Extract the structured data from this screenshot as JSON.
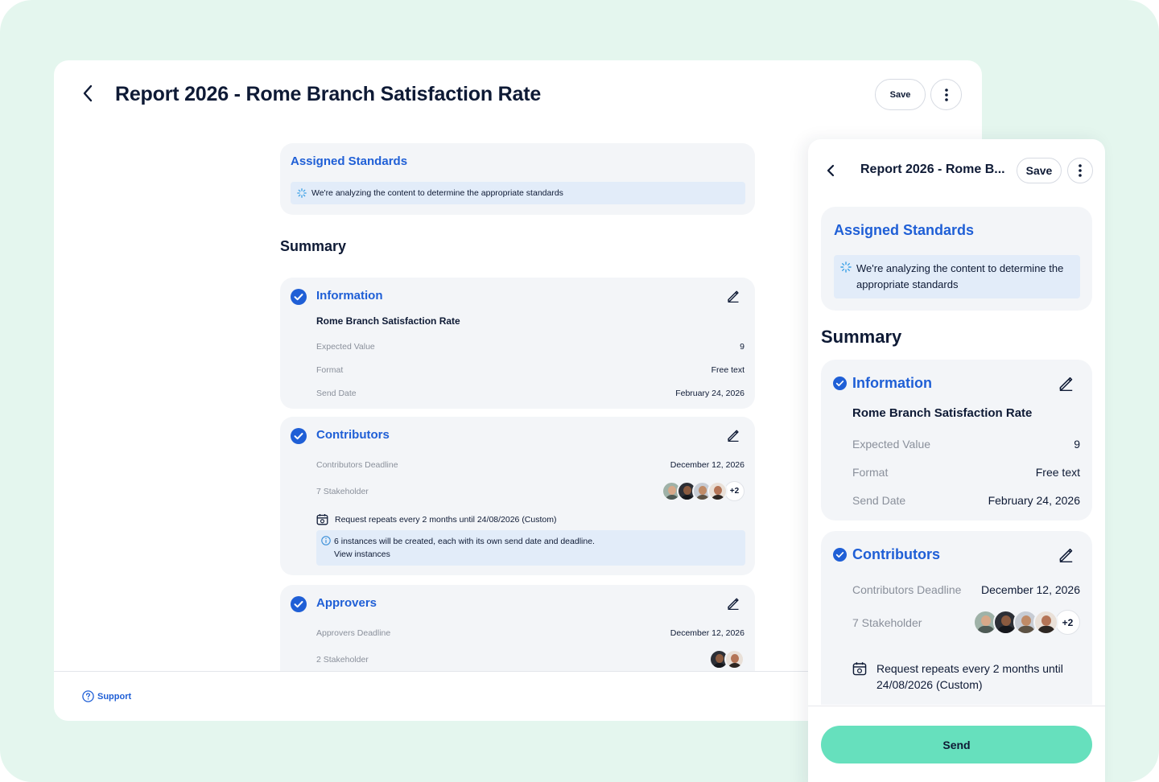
{
  "desktop": {
    "title": "Report 2026 - Rome Branch Satisfaction Rate",
    "save_label": "Save",
    "standards": {
      "title": "Assigned Standards",
      "message": "We're analyzing the content to determine the appropriate standards"
    },
    "summary_title": "Summary",
    "information": {
      "title": "Information",
      "name": "Rome Branch Satisfaction Rate",
      "rows": [
        {
          "label": "Expected Value",
          "value": "9"
        },
        {
          "label": "Format",
          "value": "Free text"
        },
        {
          "label": "Send Date",
          "value": "February 24, 2026"
        }
      ]
    },
    "contributors": {
      "title": "Contributors",
      "deadline_label": "Contributors Deadline",
      "deadline_value": "December 12, 2026",
      "stakeholder_label": "7 Stakeholder",
      "more_count": "+2",
      "repeat_text": "Request repeats every 2 months until 24/08/2026 (Custom)",
      "note_text": "6 instances will be created, each with its own send date and deadline.",
      "note_link": "View instances"
    },
    "approvers": {
      "title": "Approvers",
      "deadline_label": "Approvers Deadline",
      "deadline_value": "December 12, 2026",
      "stakeholder_label": "2 Stakeholder"
    },
    "support_label": "Support"
  },
  "mobile": {
    "title": "Report 2026 - Rome B...",
    "save_label": "Save",
    "standards": {
      "title": "Assigned Standards",
      "message": "We're analyzing the content to determine the appropriate standards"
    },
    "summary_title": "Summary",
    "information": {
      "title": "Information",
      "name": "Rome Branch Satisfaction Rate",
      "rows": [
        {
          "label": "Expected Value",
          "value": "9"
        },
        {
          "label": "Format",
          "value": "Free text"
        },
        {
          "label": "Send Date",
          "value": "February 24, 2026"
        }
      ]
    },
    "contributors": {
      "title": "Contributors",
      "deadline_label": "Contributors Deadline",
      "deadline_value": "December 12, 2026",
      "stakeholder_label": "7 Stakeholder",
      "more_count": "+2",
      "repeat_text": "Request repeats every 2 months until 24/08/2026 (Custom)"
    },
    "send_label": "Send"
  },
  "colors": {
    "accent": "#1f5fd6",
    "background": "#e4f6ee",
    "send_button": "#66e0bd",
    "banner": "#e2ecf9"
  },
  "icons": [
    "chevron-left-icon",
    "more-vertical-icon",
    "spinner-icon",
    "check-circle-icon",
    "edit-icon",
    "calendar-repeat-icon",
    "info-icon",
    "help-circle-icon"
  ]
}
